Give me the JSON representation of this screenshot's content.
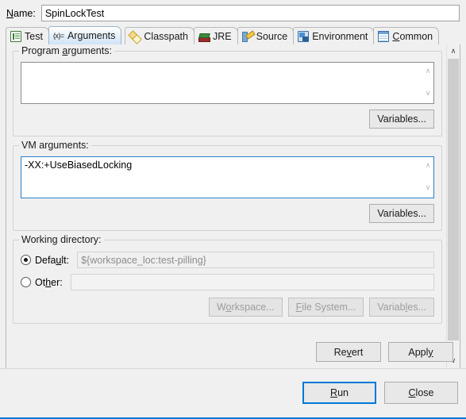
{
  "name_field": {
    "label_prefix": "N",
    "label_rest": "ame:",
    "value": "SpinLockTest"
  },
  "tabs": [
    {
      "label": "Test",
      "icon": "test-document-icon",
      "active": false
    },
    {
      "label": "Arguments",
      "icon": "variable-xequals-icon",
      "active": true
    },
    {
      "label": "Classpath",
      "icon": "classpath-arrows-icon",
      "active": false
    },
    {
      "label": "JRE",
      "icon": "jre-books-icon",
      "active": false
    },
    {
      "label": "Source",
      "icon": "source-pencil-icon",
      "active": false
    },
    {
      "label": "Environment",
      "icon": "environment-monitor-icon",
      "active": false
    },
    {
      "label": "Common",
      "icon": "common-table-icon",
      "active": false
    }
  ],
  "program_arguments": {
    "legend_a": "Program ",
    "legend_mn": "a",
    "legend_b": "rguments:",
    "value": "",
    "variables_button": "Variables..."
  },
  "vm_arguments": {
    "legend_a": "VM ar",
    "legend_mn": "g",
    "legend_b": "uments:",
    "value": "-XX:+UseBiasedLocking",
    "variables_button": "Variables...",
    "focused": true
  },
  "working_directory": {
    "legend": "Working directory:",
    "default_radio": {
      "label_a": "Defa",
      "label_mn": "u",
      "label_b": "lt:",
      "selected": true,
      "value": "${workspace_loc:test-pilling}"
    },
    "other_radio": {
      "label_a": "Ot",
      "label_mn": "h",
      "label_b": "er:",
      "selected": false,
      "value": ""
    },
    "buttons": [
      {
        "label_a": "W",
        "label_mn": "o",
        "label_b": "rkspace...",
        "enabled": false
      },
      {
        "label_a": "",
        "label_mn": "F",
        "label_b": "ile System...",
        "enabled": false
      },
      {
        "label_a": "Variab",
        "label_mn": "l",
        "label_b": "es...",
        "enabled": false
      }
    ]
  },
  "apply_bar": {
    "revert": {
      "label_a": "Re",
      "label_mn": "v",
      "label_b": "ert"
    },
    "apply": {
      "label_a": "Appl",
      "label_mn": "y",
      "label_b": ""
    }
  },
  "footer": {
    "run": {
      "label_a": "",
      "label_mn": "R",
      "label_b": "un",
      "is_default": true
    },
    "close": {
      "label_a": "",
      "label_mn": "C",
      "label_b": "lose",
      "is_default": false
    }
  },
  "scrollbar": {
    "up_arrow": "∧",
    "down_arrow": "∨"
  },
  "colors": {
    "accent_blue": "#0078d7",
    "focus_border": "#2a7fc9",
    "dialog_bg": "#f0f0f0",
    "disabled_text": "#9d9d9d"
  }
}
